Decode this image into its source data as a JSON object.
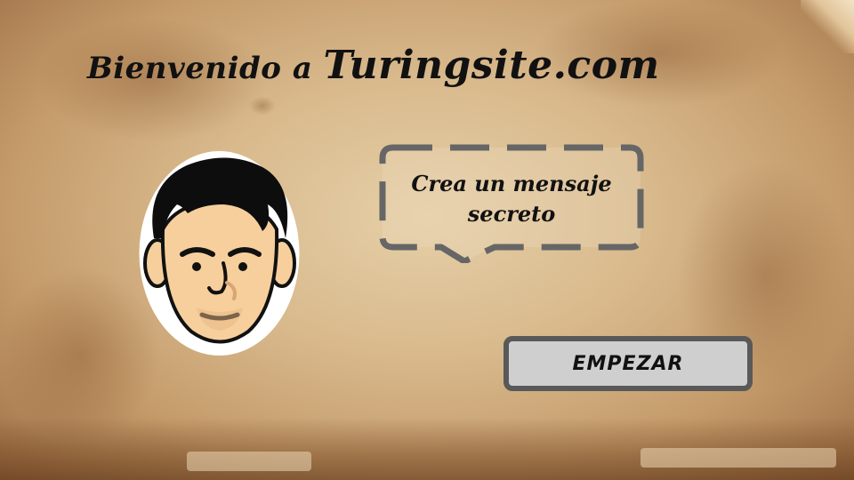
{
  "header": {
    "welcome_text": "Bienvenido a",
    "brand_text": "Turingsite.com"
  },
  "speech_bubble": {
    "line1": "Crea un mensaje",
    "line2": "secreto"
  },
  "start_button": {
    "label": "EMPEZAR"
  },
  "icons": {
    "avatar": "alan-turing-cartoon-face",
    "bubble": "dashed-speech-bubble"
  },
  "colors": {
    "parchment": "#d8b98c",
    "text": "#111111",
    "button_fill": "#cfcfcf",
    "button_border": "#595959",
    "bubble_stroke": "#666666"
  }
}
